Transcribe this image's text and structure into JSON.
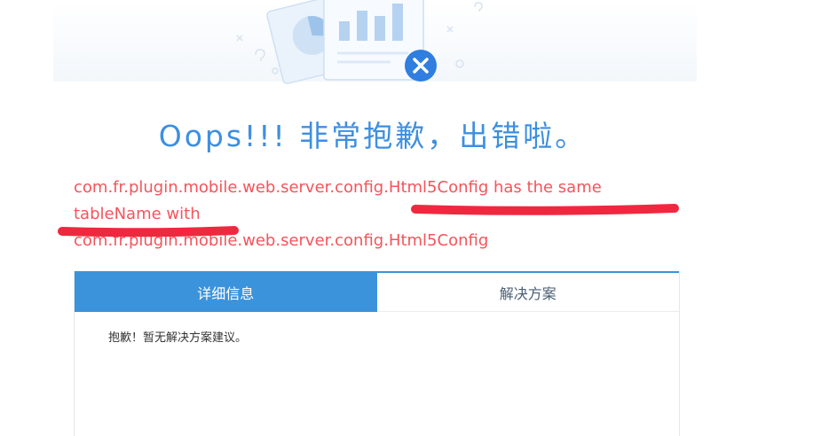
{
  "headline": "Oops!!! 非常抱歉，出错啦。",
  "error": {
    "line1": "com.fr.plugin.mobile.web.server.config.Html5Config has the same",
    "line2": "tableName with",
    "line3": "com.fr.plugin.mobile.web.server.config.Html5Config"
  },
  "tabs": [
    {
      "label": "详细信息",
      "active": true
    },
    {
      "label": "解决方案",
      "active": false
    }
  ],
  "panel_text": "抱歉！暂无解决方案建议。",
  "colors": {
    "headline": "#3d8fe0",
    "error_text": "#f4545b",
    "annotation": "#f0283f",
    "tab_active": "#3b93dc",
    "close_badge": "#2f7ee0"
  },
  "icons": [
    "report-illustration-icon",
    "pie-chart-icon",
    "bar-chart-icon",
    "close-icon",
    "question-mark-icon"
  ]
}
